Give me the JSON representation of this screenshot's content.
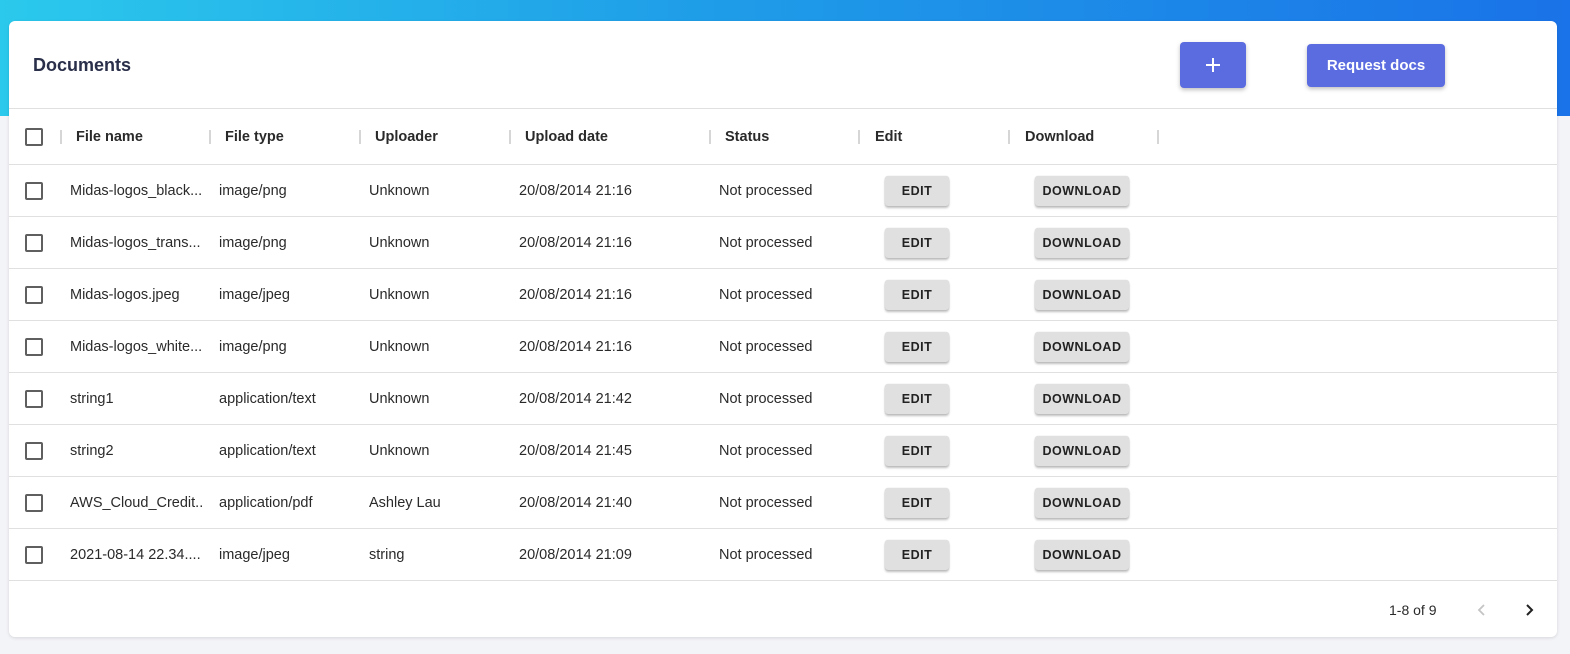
{
  "panel": {
    "title": "Documents",
    "add_label": "+",
    "request_label": "Request docs"
  },
  "columns": [
    "File name",
    "File type",
    "Uploader",
    "Upload date",
    "Status",
    "Edit",
    "Download"
  ],
  "rows": [
    {
      "file_name": "Midas-logos_black...",
      "file_type": "image/png",
      "uploader": "Unknown",
      "upload_date": "20/08/2014 21:16",
      "status": "Not processed",
      "edit": "EDIT",
      "download": "DOWNLOAD"
    },
    {
      "file_name": "Midas-logos_trans...",
      "file_type": "image/png",
      "uploader": "Unknown",
      "upload_date": "20/08/2014 21:16",
      "status": "Not processed",
      "edit": "EDIT",
      "download": "DOWNLOAD"
    },
    {
      "file_name": "Midas-logos.jpeg",
      "file_type": "image/jpeg",
      "uploader": "Unknown",
      "upload_date": "20/08/2014 21:16",
      "status": "Not processed",
      "edit": "EDIT",
      "download": "DOWNLOAD"
    },
    {
      "file_name": "Midas-logos_white...",
      "file_type": "image/png",
      "uploader": "Unknown",
      "upload_date": "20/08/2014 21:16",
      "status": "Not processed",
      "edit": "EDIT",
      "download": "DOWNLOAD"
    },
    {
      "file_name": "string1",
      "file_type": "application/text",
      "uploader": "Unknown",
      "upload_date": "20/08/2014 21:42",
      "status": "Not processed",
      "edit": "EDIT",
      "download": "DOWNLOAD"
    },
    {
      "file_name": "string2",
      "file_type": "application/text",
      "uploader": "Unknown",
      "upload_date": "20/08/2014 21:45",
      "status": "Not processed",
      "edit": "EDIT",
      "download": "DOWNLOAD"
    },
    {
      "file_name": "AWS_Cloud_Credit...",
      "file_type": "application/pdf",
      "uploader": "Ashley Lau",
      "upload_date": "20/08/2014 21:40",
      "status": "Not processed",
      "edit": "EDIT",
      "download": "DOWNLOAD"
    },
    {
      "file_name": "2021-08-14 22.34....",
      "file_type": "image/jpeg",
      "uploader": "string",
      "upload_date": "20/08/2014 21:09",
      "status": "Not processed",
      "edit": "EDIT",
      "download": "DOWNLOAD"
    }
  ],
  "pagination": {
    "range_text": "1-8 of 9",
    "prev_icon": "chevron-left-icon",
    "next_icon": "chevron-right-icon"
  },
  "colors": {
    "accent": "#5b6be0",
    "gradient_start": "#2bc9ec",
    "gradient_end": "#1a73e8"
  }
}
